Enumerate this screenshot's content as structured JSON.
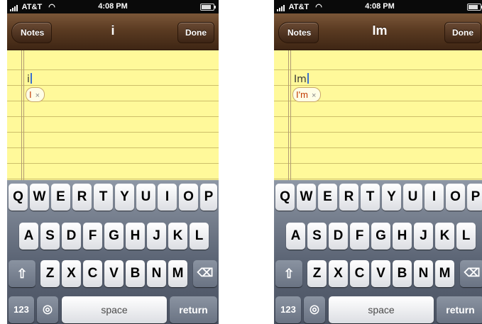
{
  "screens": [
    {
      "status": {
        "carrier": "AT&T",
        "time": "4:08 PM"
      },
      "nav": {
        "back": "Notes",
        "title": "i",
        "done": "Done"
      },
      "note": {
        "typed": "i",
        "suggestion": "I",
        "dismiss": "×"
      },
      "keyboard": {
        "row1": [
          "Q",
          "W",
          "E",
          "R",
          "T",
          "Y",
          "U",
          "I",
          "O",
          "P"
        ],
        "row2": [
          "A",
          "S",
          "D",
          "F",
          "G",
          "H",
          "J",
          "K",
          "L"
        ],
        "row3": [
          "Z",
          "X",
          "C",
          "V",
          "B",
          "N",
          "M"
        ],
        "numbers": "123",
        "space": "space",
        "return": "return"
      }
    },
    {
      "status": {
        "carrier": "AT&T",
        "time": "4:08 PM"
      },
      "nav": {
        "back": "Notes",
        "title": "Im",
        "done": "Done"
      },
      "note": {
        "typed": "Im",
        "suggestion": "I'm",
        "dismiss": "×"
      },
      "keyboard": {
        "row1": [
          "Q",
          "W",
          "E",
          "R",
          "T",
          "Y",
          "U",
          "I",
          "O",
          "P"
        ],
        "row2": [
          "A",
          "S",
          "D",
          "F",
          "G",
          "H",
          "J",
          "K",
          "L"
        ],
        "row3": [
          "Z",
          "X",
          "C",
          "V",
          "B",
          "N",
          "M"
        ],
        "numbers": "123",
        "space": "space",
        "return": "return"
      }
    }
  ],
  "icons": {
    "shift": "shift-icon",
    "delete": "delete-icon",
    "globe": "globe-icon",
    "wifi": "wifi-icon",
    "battery": "battery-icon"
  }
}
